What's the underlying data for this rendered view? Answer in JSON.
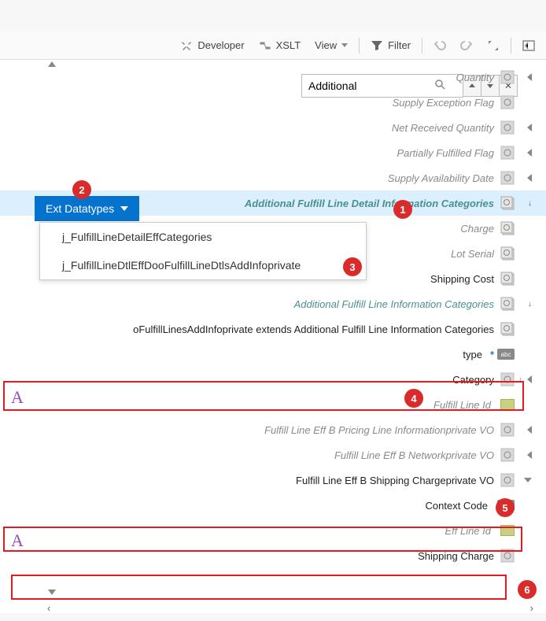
{
  "toolbar": {
    "developer": "Developer",
    "xslt": "XSLT",
    "view": "View",
    "filter": "Filter"
  },
  "search": {
    "value": "Additional"
  },
  "dropdown": {
    "button_label": "Ext Datatypes",
    "items": [
      "j_FulfillLineDetailEffCategories",
      "j_FulfillLineDtlEffDooFulfillLineDtlsAddInfoprivate"
    ]
  },
  "rows": {
    "quantity": "Quantity",
    "supply_exception": "Supply Exception Flag",
    "net_received": "Net Received Quantity",
    "partially_fulfilled": "Partially Fulfilled Flag",
    "supply_availability": "Supply Availability Date",
    "addl_detail_cat": "Additional Fulfill Line Detail Information Categories",
    "charge": "Charge",
    "lot_serial": "Lot Serial",
    "shipping_cost": "Shipping Cost",
    "addl_info_cat": "Additional Fulfill Line Information Categories",
    "extends": "oFulfillLinesAddInfoprivate extends Additional Fulfill Line Information Categories",
    "type": "type",
    "category": "Category",
    "fulfill_line_id": "Fulfill Line Id",
    "pricing_vo": "Fulfill Line Eff B Pricing Line Informationprivate VO",
    "network_vo": "Fulfill Line Eff B Networkprivate VO",
    "shipping_charge_vo": "Fulfill Line Eff B Shipping Chargeprivate VO",
    "context_code": "Context Code",
    "eff_line_id": "Eff Line Id",
    "shipping_charge": "Shipping Charge"
  },
  "badges": {
    "b1": "1",
    "b2": "2",
    "b3": "3",
    "b4": "4",
    "b5": "5",
    "b6": "6"
  },
  "markers": {
    "a": "A",
    "abc": "abc"
  }
}
